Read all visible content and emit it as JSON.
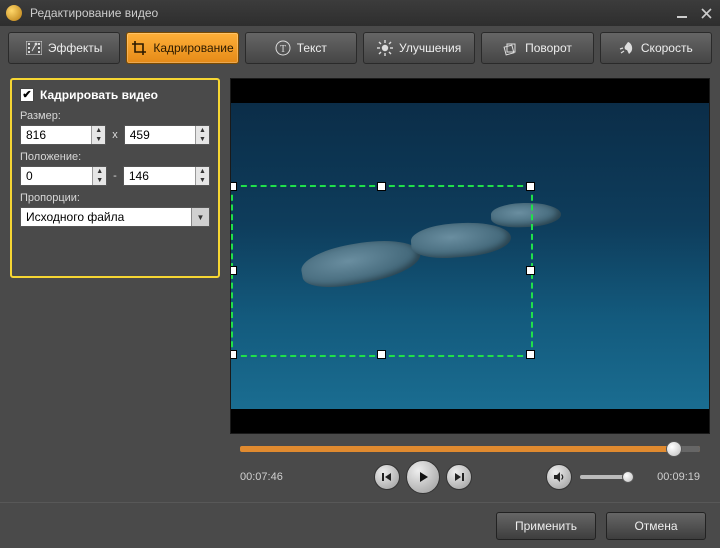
{
  "window": {
    "title": "Редактирование видео"
  },
  "tabs": {
    "effects": {
      "label": "Эффекты"
    },
    "crop": {
      "label": "Кадрирование"
    },
    "text": {
      "label": "Текст"
    },
    "enhance": {
      "label": "Улучшения"
    },
    "rotate": {
      "label": "Поворот"
    },
    "speed": {
      "label": "Скорость"
    }
  },
  "crop_panel": {
    "checkbox_label": "Кадрировать видео",
    "size_label": "Размер:",
    "size_w": "816",
    "size_h": "459",
    "size_sep": "x",
    "pos_label": "Положение:",
    "pos_x": "0",
    "pos_y": "146",
    "pos_sep": "-",
    "aspect_label": "Пропорции:",
    "aspect_value": "Исходного файла"
  },
  "playback": {
    "time_current": "00:07:46",
    "time_total": "00:09:19"
  },
  "footer": {
    "apply": "Применить",
    "cancel": "Отмена"
  }
}
